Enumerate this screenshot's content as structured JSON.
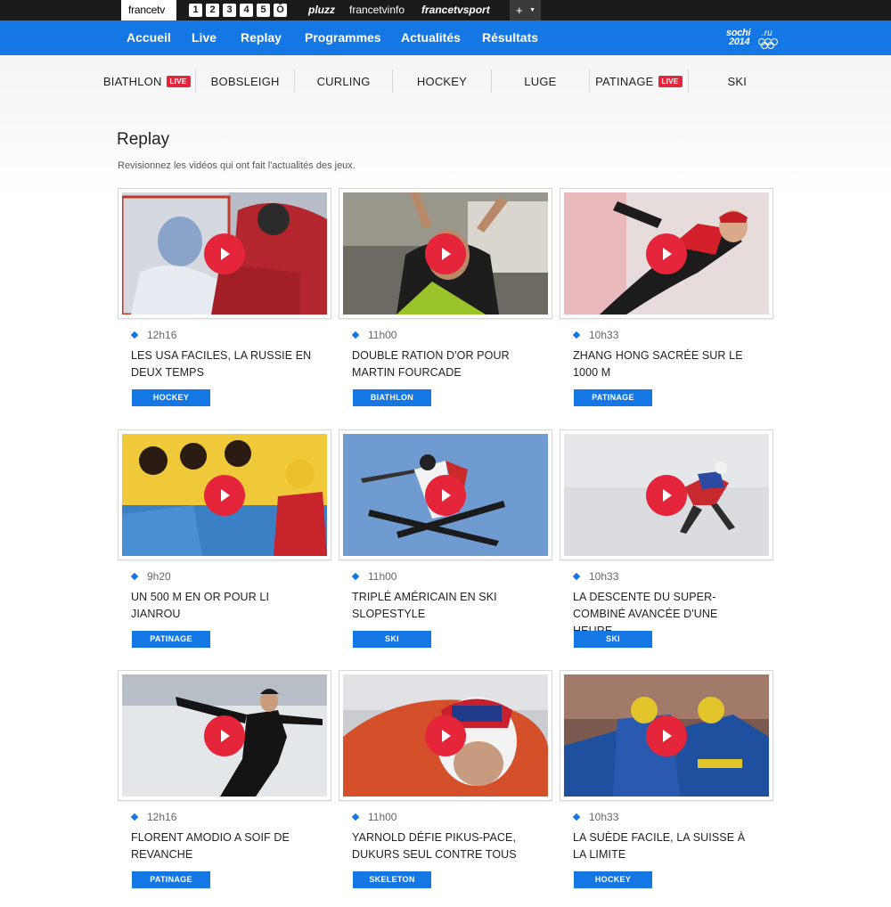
{
  "topbar": {
    "brand": "francetv",
    "channels": [
      "1",
      "2",
      "3",
      "4",
      "5",
      "Ô"
    ],
    "links": [
      "pluzz",
      "francetvinfo",
      "francetvsport"
    ],
    "plus": "+"
  },
  "nav": {
    "items": [
      "Accueil",
      "Live",
      "Replay",
      "Programmes",
      "Actualités",
      "Résultats"
    ],
    "logo_line1": "sochi",
    "logo_line2": "2014",
    "logo_ru": ".ru"
  },
  "sports": [
    {
      "label": "BIATHLON",
      "badge": "LIVE"
    },
    {
      "label": "BOBSLEIGH",
      "badge": ""
    },
    {
      "label": "CURLING",
      "badge": ""
    },
    {
      "label": "HOCKEY",
      "badge": ""
    },
    {
      "label": "LUGE",
      "badge": ""
    },
    {
      "label": "PATINAGE",
      "badge": "LIVE"
    },
    {
      "label": "SKI",
      "badge": ""
    }
  ],
  "main": {
    "title": "Replay",
    "subtitle": "Revisionnez les vidéos qui ont fait l'actualités des jeux."
  },
  "cards": [
    {
      "time": "12h16",
      "title": "LES USA FACILES, LA RUSSIE EN DEUX TEMPS",
      "tag": "HOCKEY"
    },
    {
      "time": "11h00",
      "title": "DOUBLE RATION D'OR POUR MARTIN FOURCADE",
      "tag": "BIATHLON"
    },
    {
      "time": "10h33",
      "title": "ZHANG HONG SACRÉE SUR LE 1000 M",
      "tag": "PATINAGE"
    },
    {
      "time": "9h20",
      "title": "UN 500 M EN OR POUR LI JIANROU",
      "tag": "PATINAGE"
    },
    {
      "time": "11h00",
      "title": "TRIPLÉ AMÉRICAIN EN SKI SLOPESTYLE",
      "tag": "SKI"
    },
    {
      "time": "10h33",
      "title": "LA DESCENTE DU SUPER-COMBINÉ AVANCÉE D'UNE HEURE",
      "tag": "SKI"
    },
    {
      "time": "12h16",
      "title": "FLORENT AMODIO A SOIF DE REVANCHE",
      "tag": "PATINAGE"
    },
    {
      "time": "11h00",
      "title": "YARNOLD DÉFIE PIKUS-PACE, DUKURS SEUL CONTRE TOUS",
      "tag": "SKELETON"
    },
    {
      "time": "10h33",
      "title": "LA SUÈDE FACILE, LA SUISSE À LA LIMITE",
      "tag": "HOCKEY"
    }
  ],
  "colors": {
    "accent": "#1577e3",
    "live": "#e4253a",
    "topbar": "#1a1a1a"
  }
}
